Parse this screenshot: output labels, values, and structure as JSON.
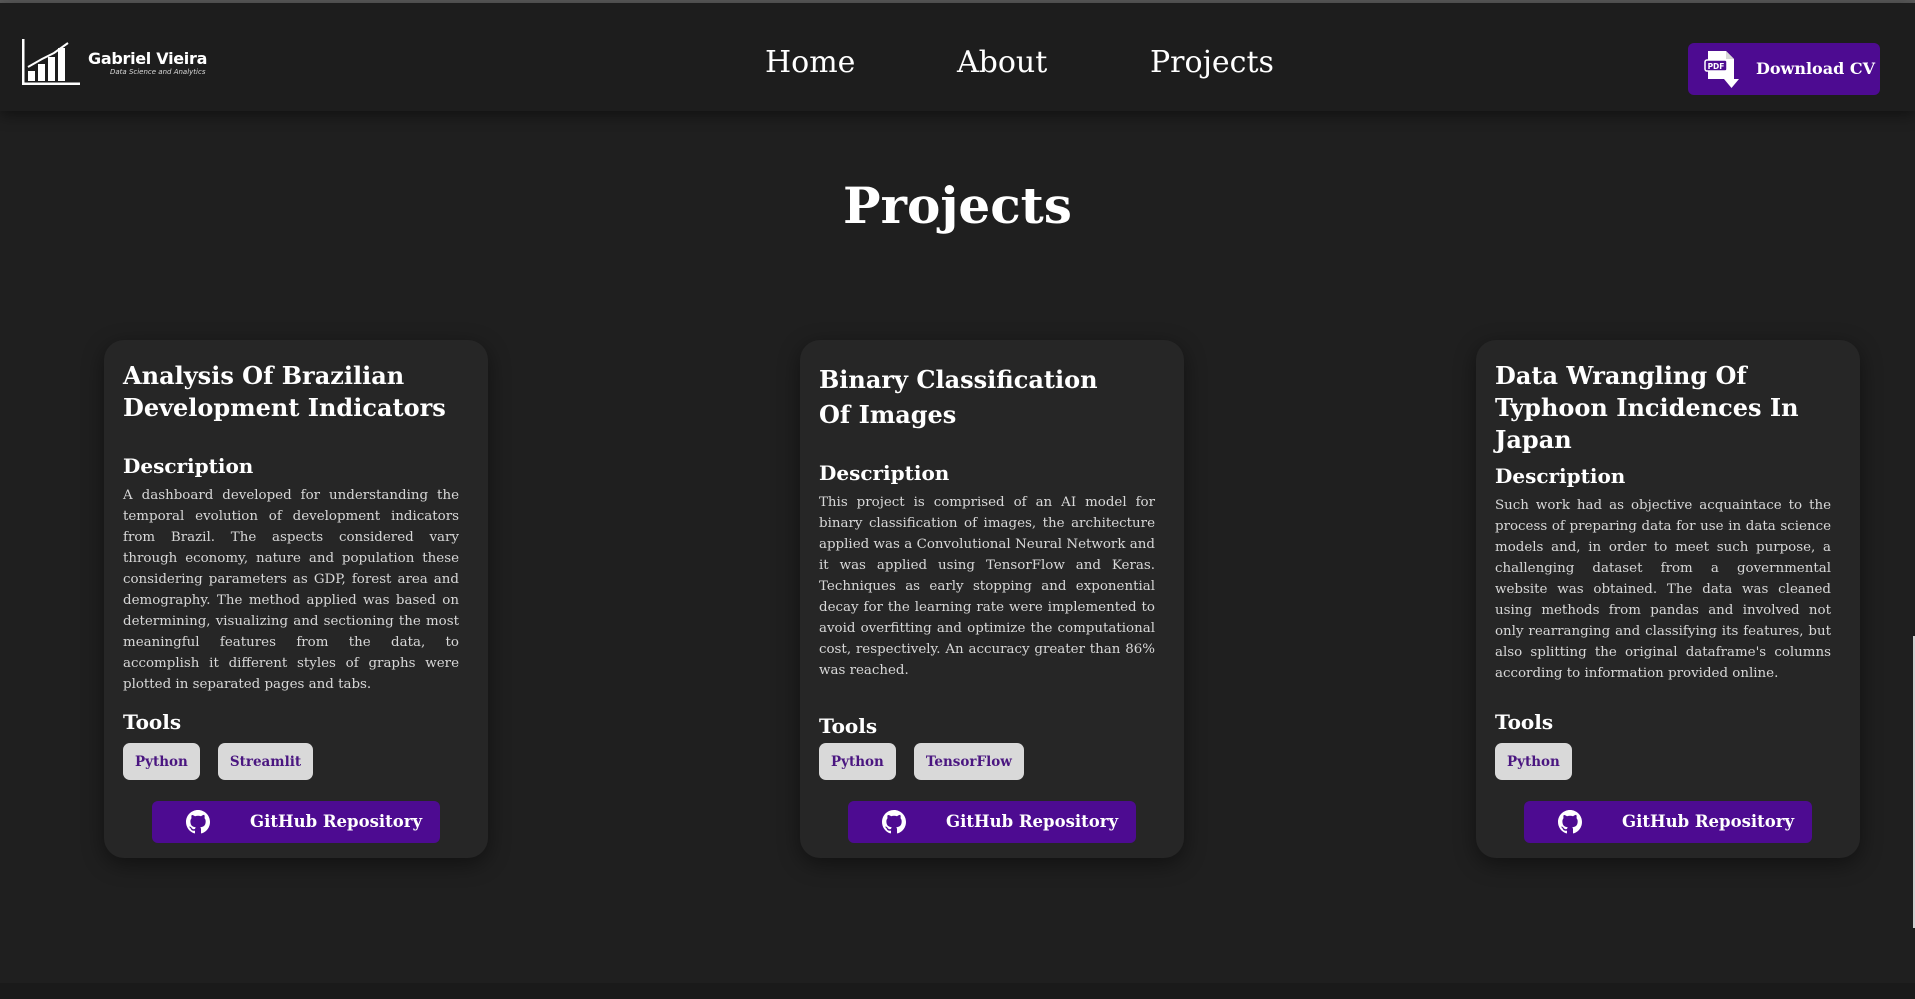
{
  "brand": {
    "name": "Gabriel Vieira",
    "tagline": "Data Science and Analytics"
  },
  "nav": {
    "links": [
      {
        "label": "Home"
      },
      {
        "label": "About"
      },
      {
        "label": "Projects"
      }
    ],
    "cv_button": {
      "label": "Download CV",
      "icon": "pdf-icon",
      "icon_text": "PDF"
    }
  },
  "page": {
    "title": "Projects"
  },
  "projects": [
    {
      "title": "Analysis Of Brazilian Development Indicators",
      "description_heading": "Description",
      "description": "A dashboard developed for understanding the temporal evolution of development indicators from Brazil. The aspects considered vary through economy, nature and population these considering parameters as GDP, forest area and demography. The method applied was based on determining, visualizing and sectioning the most meaningful features from the data, to accomplish it different styles of graphs were plotted in separated pages and tabs.",
      "tools_heading": "Tools",
      "tools": [
        "Python",
        "Streamlit"
      ],
      "link_label": "GitHub Repository"
    },
    {
      "title": "Binary Classification Of Images",
      "description_heading": "Description",
      "description": "This project is comprised of an AI model for binary classification of images, the architecture applied was a Convolutional Neural Network and it was applied using TensorFlow and Keras. Techniques as early stopping and exponential decay for the learning rate were implemented to avoid overfitting and optimize the computational cost, respectively. An accuracy greater than 86% was reached.",
      "tools_heading": "Tools",
      "tools": [
        "Python",
        "TensorFlow"
      ],
      "link_label": "GitHub Repository"
    },
    {
      "title": "Data Wrangling Of Typhoon Incidences In Japan",
      "description_heading": "Description",
      "description": "Such work had as objective acquaintace to the process of preparing data for use in data science models and, in order to meet such purpose, a challenging dataset from a governmental website was obtained. The data was cleaned using methods from pandas and involved not only rearranging and classifying its features, but also splitting the original dataframe's columns according to information provided online.",
      "tools_heading": "Tools",
      "tools": [
        "Python"
      ],
      "link_label": "GitHub Repository"
    }
  ],
  "colors": {
    "background": "#1f1f1f",
    "card": "#262626",
    "accent": "#4d0b91",
    "badge_bg": "#d9d9d9",
    "badge_text": "#4a1680"
  }
}
